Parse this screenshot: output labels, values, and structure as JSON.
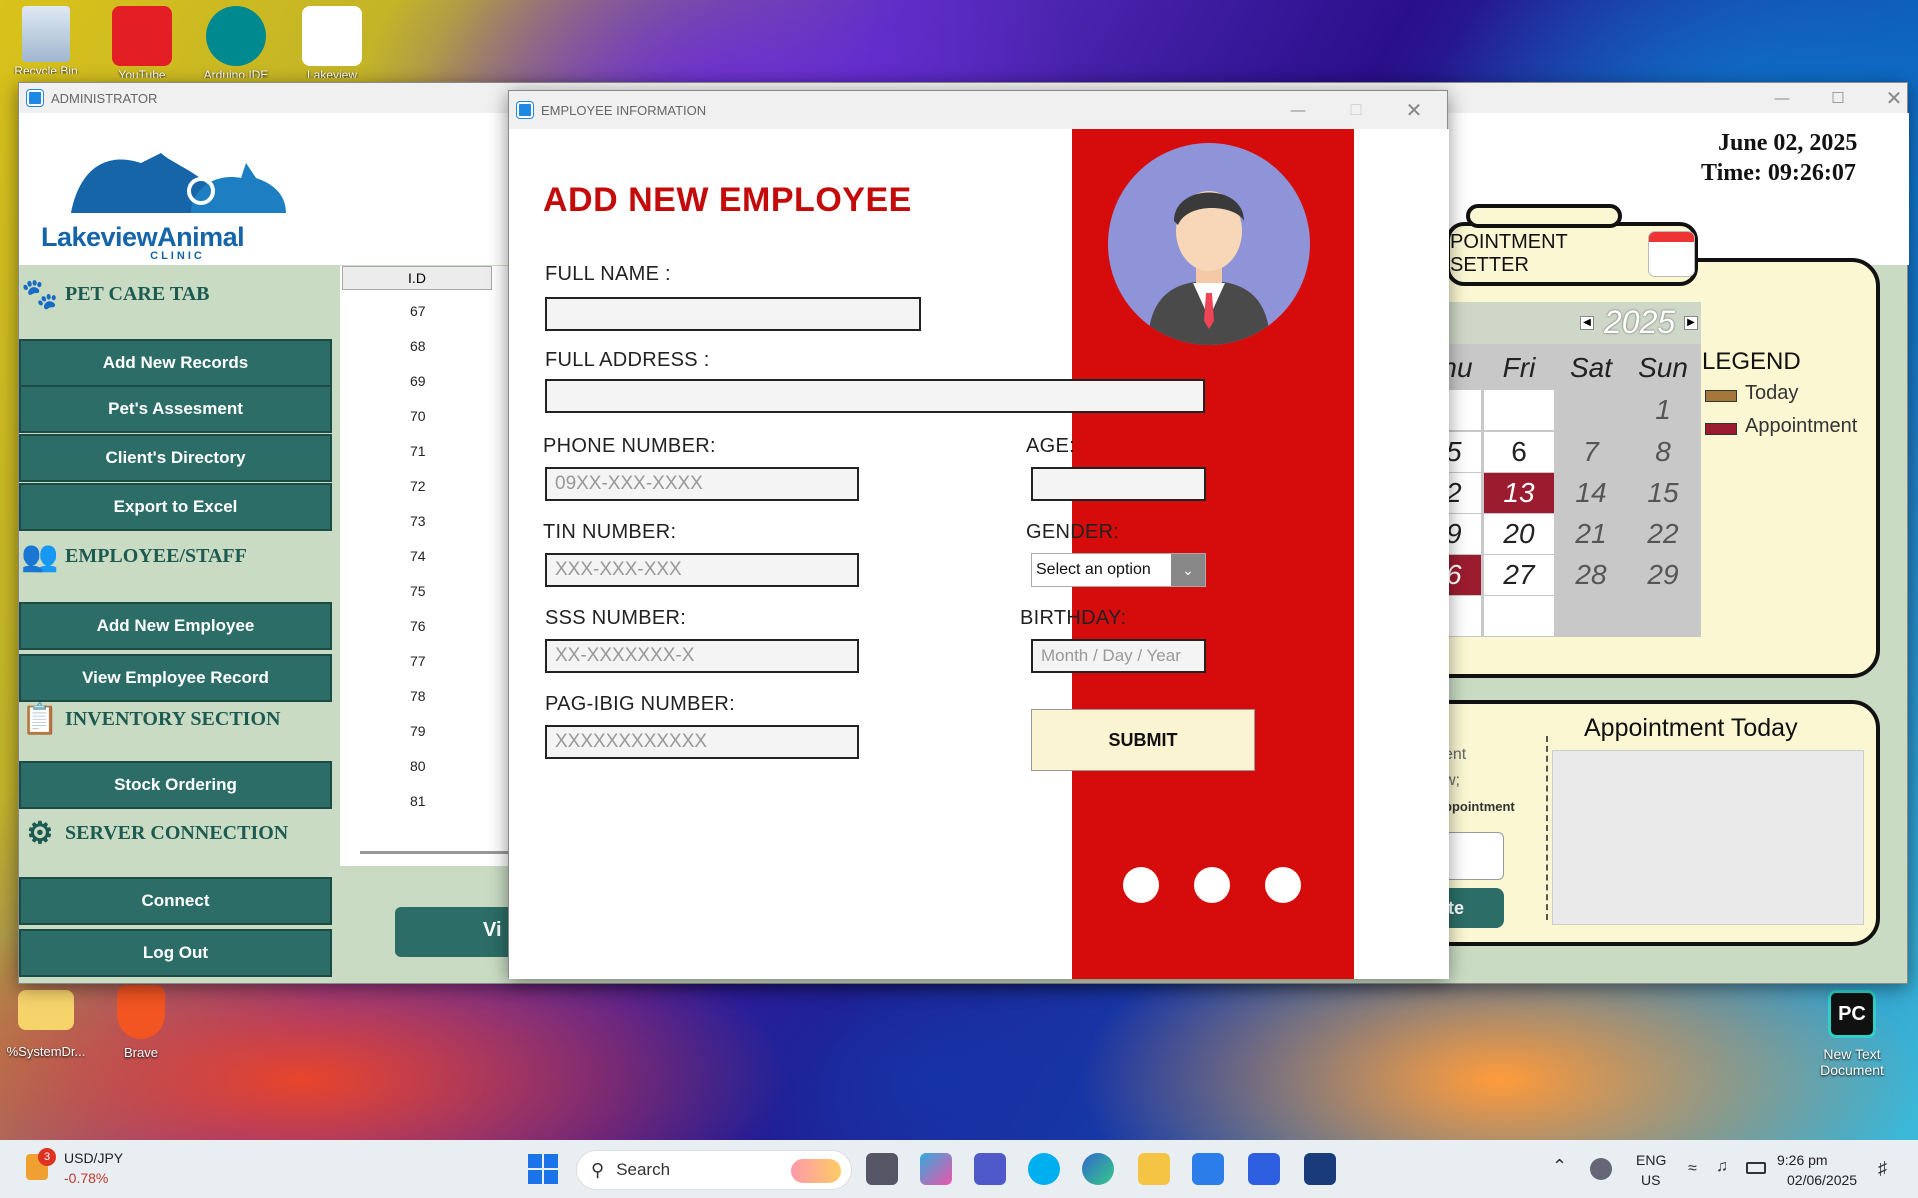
{
  "desktop": {
    "icons_top": [
      {
        "label": "Recycle Bin"
      },
      {
        "label": "YouTube"
      },
      {
        "label": "Arduino IDE"
      },
      {
        "label": "Lakeview"
      }
    ],
    "icons_bottom": [
      {
        "label": "%SystemDr..."
      },
      {
        "label": "Brave"
      },
      {
        "label": "New Text Document"
      }
    ],
    "pc_badge": "PC"
  },
  "admin": {
    "title": "ADMINISTRATOR",
    "logo_text": "LakeviewAnimal",
    "logo_sub": "C L I N I C",
    "sections": {
      "pet": "PET CARE TAB",
      "employee": "EMPLOYEE/STAFF",
      "inventory": "INVENTORY SECTION",
      "server": "SERVER CONNECTION"
    },
    "buttons": {
      "add_records": "Add New Records",
      "assessment": "Pet's Assesment",
      "directory": "Client's Directory",
      "export": "Export to Excel",
      "add_employee": "Add New Employee",
      "view_employee": "View Employee Record",
      "stock": "Stock Ordering",
      "connect": "Connect",
      "logout": "Log Out",
      "view_partial": "Vi"
    },
    "table": {
      "header": "I.D",
      "ids": [
        "67",
        "68",
        "69",
        "70",
        "71",
        "72",
        "73",
        "74",
        "75",
        "76",
        "77",
        "78",
        "79",
        "80",
        "81"
      ]
    },
    "date": "June 02, 2025",
    "time": "Time:  09:26:07",
    "appointment_setter": "POINTMENT SETTER",
    "calendar": {
      "year": "2025",
      "days": [
        "hu",
        "Fri",
        "Sat",
        "Sun"
      ],
      "weeks": [
        [
          "",
          "",
          "",
          "1"
        ],
        [
          "5",
          "6",
          "7",
          "8"
        ],
        [
          "2",
          "13",
          "14",
          "15"
        ],
        [
          "9",
          "20",
          "21",
          "22"
        ],
        [
          "6",
          "27",
          "28",
          "29"
        ],
        [
          "",
          "",
          "",
          ""
        ]
      ]
    },
    "legend": {
      "title": "LEGEND",
      "today": "Today",
      "appointment": "Appointment",
      "today_color": "#a5773a",
      "appointment_color": "#9b1c2e"
    },
    "appointment_today": "Appointment Today",
    "left_partial": [
      "ent",
      "w;",
      "ppointment"
    ],
    "te_button": "te"
  },
  "dialog": {
    "title": "EMPLOYEE INFORMATION",
    "heading": "ADD NEW EMPLOYEE",
    "labels": {
      "full_name": "FULL NAME :",
      "full_address": "FULL ADDRESS :",
      "phone": "PHONE NUMBER:",
      "age": "AGE:",
      "tin": "TIN NUMBER:",
      "gender": "GENDER:",
      "sss": "SSS NUMBER:",
      "birthday": "BIRTHDAY:",
      "pagibig": "PAG-IBIG NUMBER:"
    },
    "placeholders": {
      "phone": "09XX-XXX-XXXX",
      "tin": "XXX-XXX-XXX",
      "sss": "XX-XXXXXXX-X",
      "pagibig": "XXXXXXXXXXXX",
      "birthday": "Month / Day / Year"
    },
    "gender_select": "Select an option",
    "submit": "SUBMIT",
    "accent_color": "#d60b0b"
  },
  "taskbar": {
    "ticker_badge": "3",
    "ticker_pair": "USD/JPY",
    "ticker_change": "-0.78%",
    "search": "Search",
    "lang1": "ENG",
    "lang2": "US",
    "time": "9:26 pm",
    "date": "02/06/2025"
  }
}
